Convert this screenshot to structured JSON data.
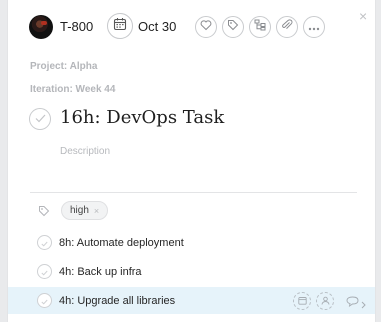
{
  "header": {
    "assignee": "T-800",
    "due_date": "Oct 30",
    "icons": [
      "heart-icon",
      "tag-icon",
      "subtask-icon",
      "attachment-icon",
      "more-icon"
    ],
    "close_symbol": "×"
  },
  "task": {
    "project_label": "Project: Alpha",
    "iteration_label": "Iteration: Week 44",
    "title": "16h: DevOps Task",
    "description_placeholder": "Description"
  },
  "tags": [
    "high"
  ],
  "tag_remove_symbol": "×",
  "subtasks": [
    {
      "title": "8h: Automate deployment"
    },
    {
      "title": "4h: Back up infra"
    },
    {
      "title": "4h: Upgrade all libraries"
    }
  ],
  "colors": {
    "highlight_row": "#e6f3fa",
    "icon_border": "#c9cbce",
    "muted_text": "#b4b6ba"
  }
}
